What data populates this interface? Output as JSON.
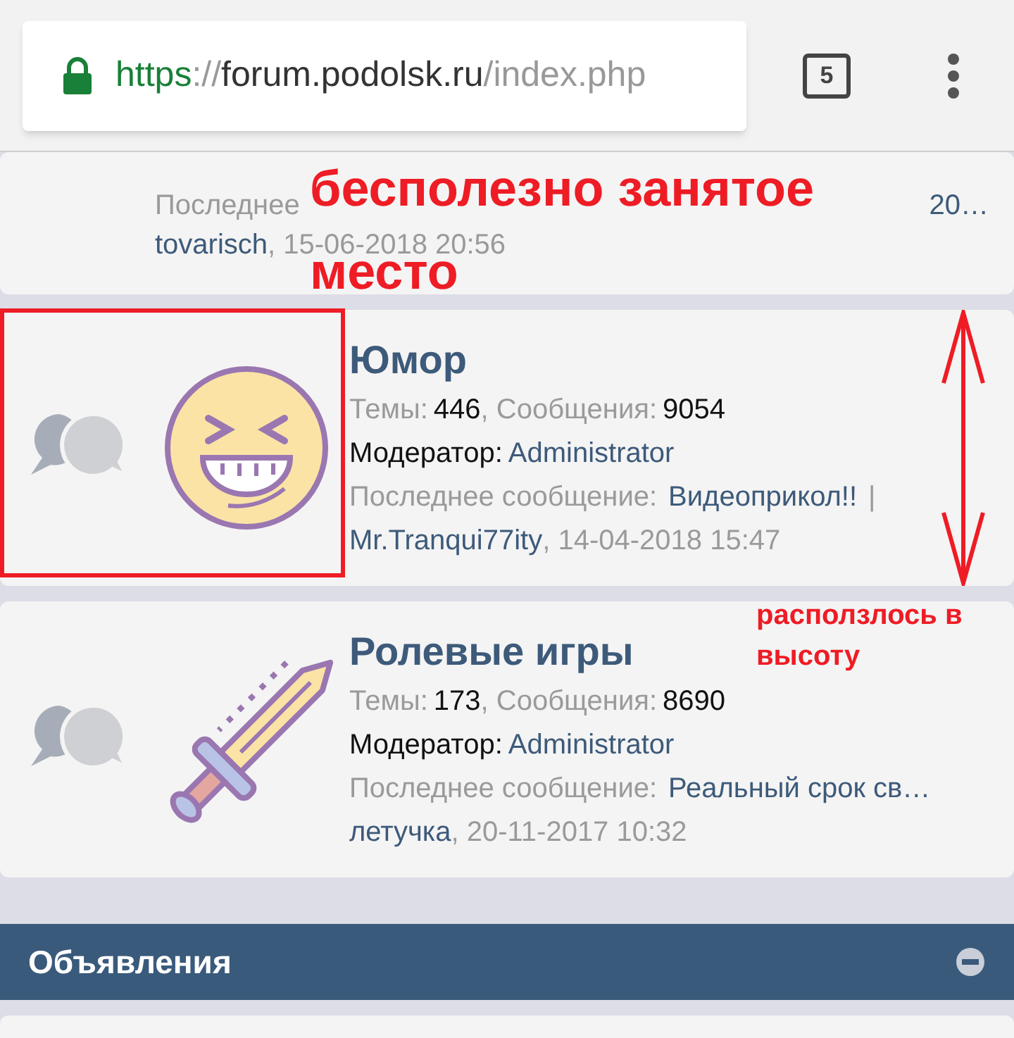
{
  "browser": {
    "url_scheme": "https",
    "url_sep": "://",
    "url_host": "forum.podolsk.ru",
    "url_path": "/index.php",
    "tab_count": "5"
  },
  "forums": [
    {
      "kind": "partial",
      "last_label": "Последнее",
      "last_topic": "20…",
      "author": "tovarisch",
      "time": ", 15-06-2018 20:56"
    },
    {
      "kind": "full",
      "title": "Юмор",
      "topics_label": "Темы:",
      "topics": "446",
      "posts_label": ", Сообщения:",
      "posts": "9054",
      "moderator_label": "Модератор:",
      "moderator": "Administrator",
      "last_label": "Последнее сообщение:",
      "last_topic": "Видеоприкол!!",
      "separator": "|",
      "author": "Mr.Tranqui77ity",
      "time": ", 14-04-2018 15:47"
    },
    {
      "kind": "full",
      "title": "Ролевые игры",
      "topics_label": "Темы:",
      "topics": "173",
      "posts_label": ", Сообщения:",
      "posts": "8690",
      "moderator_label": "Модератор:",
      "moderator": "Administrator",
      "last_label": "Последнее сообщение:",
      "last_topic": "Реальный срок св…",
      "author": "летучка",
      "time": ", 20-11-2017 10:32"
    }
  ],
  "section": {
    "title": "Объявления",
    "expanded": true
  },
  "annotations": [
    {
      "text": "бесполезно занятое"
    },
    {
      "text": "место"
    },
    {
      "text": "расползлось в высоту"
    }
  ]
}
